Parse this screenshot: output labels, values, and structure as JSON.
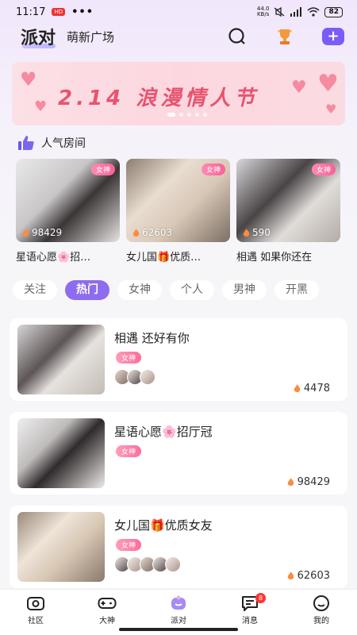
{
  "status": {
    "time": "11:17",
    "badge": "HD",
    "network": "44.0\nKB/s",
    "battery": "82"
  },
  "nav": {
    "brand": "派对",
    "subtitle": "萌新广场"
  },
  "banner": {
    "text": "2.14 浪漫情人节"
  },
  "popular": {
    "title": "人气房间",
    "rooms": [
      {
        "name": "星语心愿🌸招…",
        "count": "98429",
        "tag": "女神"
      },
      {
        "name": "女儿国🎁优质…",
        "count": "62603",
        "tag": "女神"
      },
      {
        "name": "相遇 如果你还在",
        "count": "590",
        "tag": "女神"
      }
    ]
  },
  "tabs": [
    "关注",
    "热门",
    "女神",
    "个人",
    "男神",
    "开黑"
  ],
  "rooms": [
    {
      "title": "相遇 还好有你",
      "tag": "女神",
      "count": "4478"
    },
    {
      "title": "星语心愿🌸招厅冠",
      "tag": "女神",
      "count": "98429"
    },
    {
      "title": "女儿国🎁优质女友",
      "tag": "女神",
      "count": "62603"
    }
  ],
  "bottom_nav": {
    "items": [
      {
        "label": "社区"
      },
      {
        "label": "大神"
      },
      {
        "label": "派对"
      },
      {
        "label": "消息",
        "badge": "8"
      },
      {
        "label": "我的"
      }
    ]
  },
  "colors": {
    "accent": "#8d6cf0",
    "tag": "#f7619a",
    "banner_text": "#e8536f"
  }
}
